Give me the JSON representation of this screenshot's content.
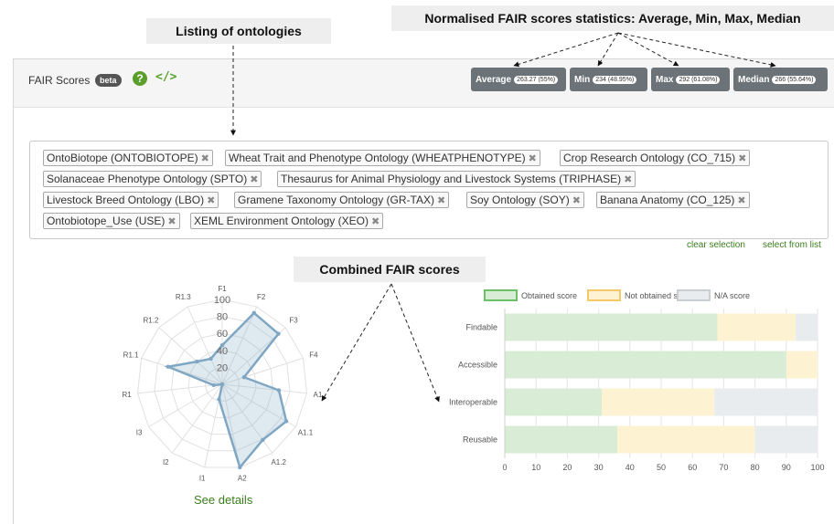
{
  "annotations": {
    "listing": "Listing of ontologies",
    "stats": "Normalised FAIR scores statistics: Average, Min, Max, Median",
    "combined": "Combined FAIR scores"
  },
  "header": {
    "title": "FAIR Scores",
    "badge": "beta",
    "help_icon": "question-circle-icon",
    "code_icon": "code-icon"
  },
  "stats": [
    {
      "label": "Average",
      "value": "263.27 (55%)"
    },
    {
      "label": "Min",
      "value": "234 (48.95%)"
    },
    {
      "label": "Max",
      "value": "292 (61.08%)"
    },
    {
      "label": "Median",
      "value": "266 (55.64%)"
    }
  ],
  "ontologies": [
    "OntoBiotope (ONTOBIOTOPE)",
    "Wheat Trait and Phenotype Ontology (WHEATPHENOTYPE)",
    "Crop Research Ontology (CO_715)",
    "Solanaceae Phenotype Ontology (SPTO)",
    "Thesaurus for Animal Physiology and Livestock Systems (TRIPHASE)",
    "Livestock Breed Ontology (LBO)",
    "Gramene Taxonomy Ontology (GR-TAX)",
    "Soy Ontology (SOY)",
    "Banana Anatomy (CO_125)",
    "Ontobiotope_Use (USE)",
    "XEML Environment Ontology (XEO)"
  ],
  "links": {
    "clear": "clear selection",
    "select": "select from list"
  },
  "see_details": "See details",
  "chart_data": [
    {
      "type": "radar",
      "axes": [
        "F1",
        "F2",
        "F3",
        "F4",
        "A1",
        "A1.1",
        "A1.2",
        "A2",
        "I1",
        "I2",
        "I3",
        "R1",
        "R1.1",
        "R1.2",
        "R1.3"
      ],
      "values": [
        46,
        92,
        89,
        27,
        67,
        87,
        81,
        100,
        18,
        0,
        0,
        10,
        67,
        40,
        33
      ],
      "range": [
        0,
        100
      ],
      "ticks": [
        20,
        40,
        60,
        80,
        100
      ],
      "color": "#7fa7c3"
    },
    {
      "type": "bar",
      "orientation": "horizontal",
      "stacked": true,
      "categories": [
        "Findable",
        "Accessible",
        "Interoperable",
        "Reusable"
      ],
      "series": [
        {
          "name": "Obtained score",
          "values": [
            68,
            90,
            31,
            36
          ],
          "color": "#d9ecd5",
          "border": "#6cc167"
        },
        {
          "name": "Not obtained score",
          "values": [
            25,
            10,
            36,
            44
          ],
          "color": "#fdf3d3",
          "border": "#f5c969"
        },
        {
          "name": "N/A score",
          "values": [
            7,
            0,
            33,
            20
          ],
          "color": "#e9ecee",
          "border": "#c9ced2"
        }
      ],
      "xlim": [
        0,
        100
      ],
      "xticks": [
        0,
        10,
        20,
        30,
        40,
        50,
        60,
        70,
        80,
        90,
        100
      ],
      "legend": "top"
    }
  ]
}
